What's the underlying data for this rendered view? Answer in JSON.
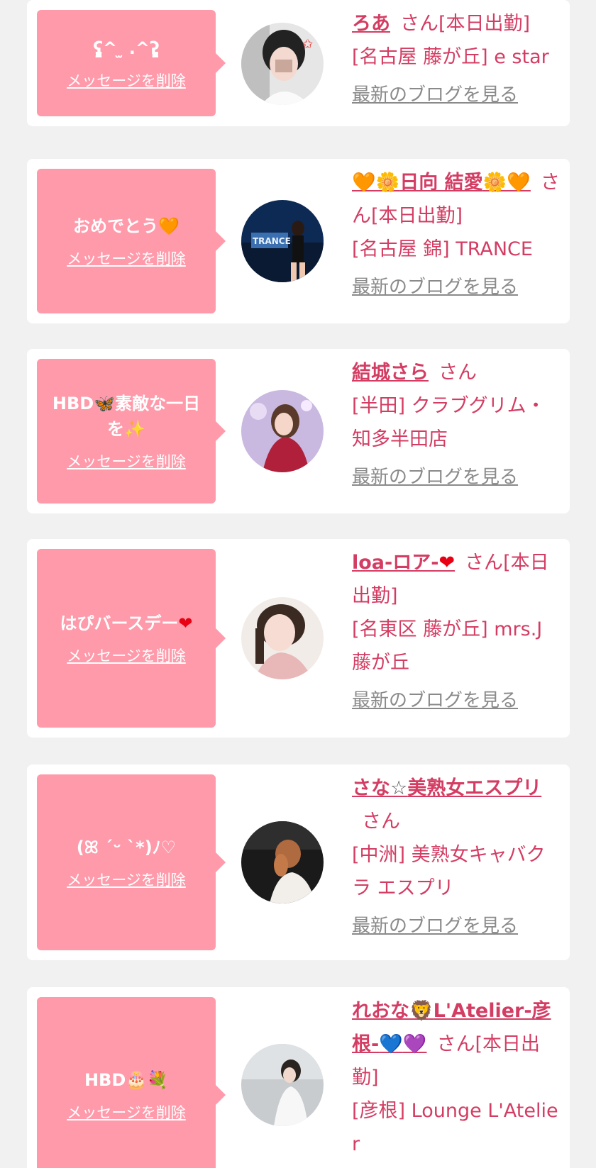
{
  "ui": {
    "delete_label": "メッセージを削除",
    "san_label": "さん",
    "blog_label": "最新のブログを見る"
  },
  "colors": {
    "page_background": "#f1f1f1",
    "card_background": "#ffffff",
    "bubble": "#ff9aaa",
    "name_text": "#d43d63",
    "blog_link": "#8a8a8a"
  },
  "cards": [
    {
      "message": "ʕ̡̢̡^ ̫ .^ʔ̢̡̢",
      "name": "ろあ",
      "status": "[本日出勤]",
      "shop": "[名古屋 藤が丘] e star",
      "avatar_icon": "avatar-photo"
    },
    {
      "message": "おめでとう",
      "message_emoji": "🧡",
      "name_pre": "🧡🌼",
      "name": "日向 結愛",
      "name_post": "🌼🧡",
      "status": "[本日出勤]",
      "shop": "[名古屋 錦] TRANCE",
      "avatar_icon": "avatar-photo"
    },
    {
      "message_pre": "HBD",
      "message_emoji_1": "🦋",
      "message_mid": "素敵な一日を",
      "message_emoji_2": "✨",
      "name": "結城さら",
      "status": "",
      "shop": "[半田] クラブグリム・知多半田店",
      "avatar_icon": "avatar-photo"
    },
    {
      "message": "はぴバースデー",
      "message_emoji": "❤",
      "name": "loa-ロア-",
      "name_emoji": "❤",
      "status": "[本日出勤]",
      "shop": "[名東区 藤が丘] mrs.J 藤が丘",
      "avatar_icon": "avatar-photo"
    },
    {
      "message": "(ꕤ ˊᵕ ˋ*)ﾉ♡",
      "name_pre": "さな",
      "name_star": "☆",
      "name_post": "美熟女エスプリ",
      "status": "",
      "shop": "[中洲] 美熟女キャバクラ エスプリ",
      "avatar_icon": "avatar-photo"
    },
    {
      "message": "HBD",
      "message_emoji_1": "🎂",
      "message_emoji_2": "💐",
      "name_pre": "れおな",
      "name_emoji_1": "🦁",
      "name_mid": "L'Atelier-彦根-",
      "name_emoji_2": "💙",
      "name_emoji_3": "💜",
      "status": "[本日出勤]",
      "shop": "[彦根] Lounge L'Atelier",
      "avatar_icon": "avatar-photo"
    }
  ]
}
